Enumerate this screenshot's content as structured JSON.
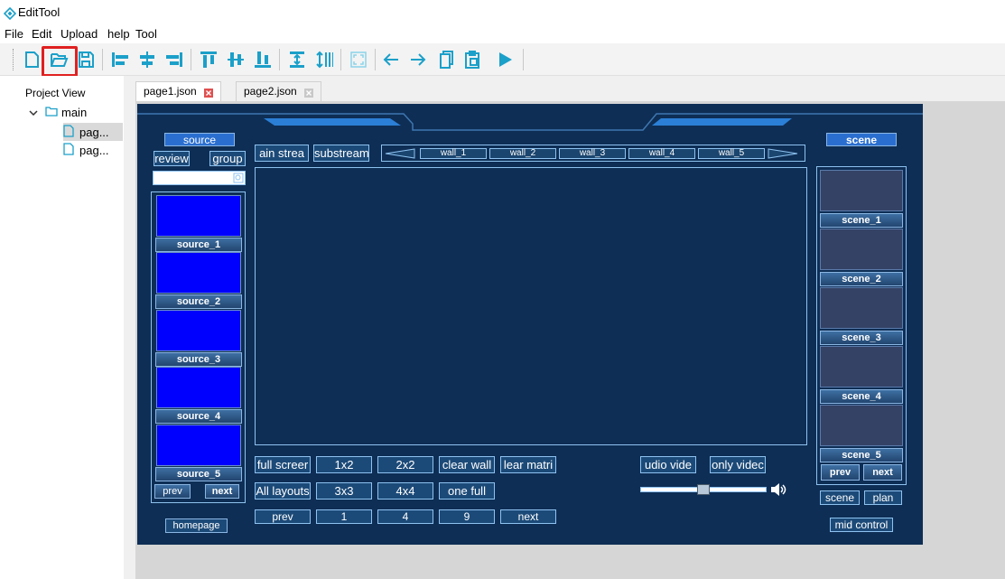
{
  "app": {
    "title": "EditTool"
  },
  "menu": [
    "File",
    "Edit",
    "Upload",
    "help",
    "Tool"
  ],
  "toolbar": {
    "icons": [
      "new-file-icon",
      "open-folder-icon",
      "save-icon",
      "align-left-icon",
      "align-center-h-icon",
      "align-right-icon",
      "align-top-icon",
      "align-center-v-icon",
      "align-bottom-icon",
      "distribute-h-icon",
      "distribute-v-icon",
      "fit-screen-icon",
      "arrow-left-icon",
      "arrow-right-icon",
      "copy-icon",
      "paste-icon",
      "run-icon"
    ],
    "accent": "#1ba0c9",
    "highlight_color": "#e02020"
  },
  "project": {
    "header": "Project View",
    "root": "main",
    "children": [
      "pag...",
      "pag..."
    ]
  },
  "tabs": [
    {
      "label": "page1.json",
      "active": true
    },
    {
      "label": "page2.json",
      "active": false
    }
  ],
  "panel": {
    "source_title": "source",
    "preview_label": "review",
    "group_label": "group",
    "sources": [
      "source_1",
      "source_2",
      "source_3",
      "source_4",
      "source_5"
    ],
    "left_prev": "prev",
    "left_next": "next",
    "homepage": "homepage",
    "main_stream": "ain strea",
    "substream": "substream",
    "walls": [
      "wall_1",
      "wall_2",
      "wall_3",
      "wall_4",
      "wall_5"
    ],
    "layout_row1": [
      "full screer",
      "1x2",
      "2x2",
      "clear wall",
      "lear matri"
    ],
    "layout_row2": [
      "All layouts",
      "3x3",
      "4x4",
      "one full"
    ],
    "page_row": [
      "prev",
      "1",
      "4",
      "9",
      "next"
    ],
    "audio_video": "udio vide",
    "only_video": "only videc",
    "scene_title": "scene",
    "scenes": [
      "scene_1",
      "scene_2",
      "scene_3",
      "scene_4",
      "scene_5"
    ],
    "right_prev": "prev",
    "right_next": "next",
    "scene_btn": "scene",
    "plan_btn": "plan",
    "mid_control": "mid control",
    "panel_color": "#0e2e55",
    "source_thumb_color": "#0000ff"
  }
}
